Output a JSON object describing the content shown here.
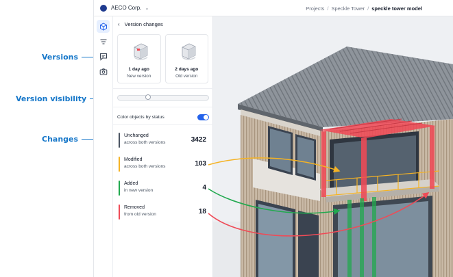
{
  "annotations": {
    "versions": "Versions",
    "version_visibility": "Version visibility",
    "changes": "Changes"
  },
  "topbar": {
    "org_name": "AECO Corp.",
    "breadcrumb": [
      "Projects",
      "Speckle Tower",
      "speckle tower model"
    ]
  },
  "toolrail": {
    "icons": [
      "cube-icon",
      "filter-icon",
      "comment-icon",
      "camera-icon"
    ]
  },
  "panel": {
    "title": "Version changes",
    "versions": [
      {
        "time": "1 day ago",
        "label": "New version"
      },
      {
        "time": "2 days ago",
        "label": "Old version"
      }
    ],
    "color_by_status_label": "Color objects by status",
    "color_by_status_on": true,
    "slider_position": 0.32,
    "changes": [
      {
        "name": "Unchanged",
        "desc": "across both versions",
        "count": "3422",
        "color": "#4b5563"
      },
      {
        "name": "Modified",
        "desc": "across both versions",
        "count": "103",
        "color": "#f5b324"
      },
      {
        "name": "Added",
        "desc": "in new version",
        "count": "4",
        "color": "#22a94f"
      },
      {
        "name": "Removed",
        "desc": "from old version",
        "count": "18",
        "color": "#ef4b57"
      }
    ]
  },
  "colors": {
    "accent": "#1677c9",
    "toggle": "#2563eb",
    "modified": "#f5b324",
    "added": "#22a94f",
    "removed": "#ef4b57"
  }
}
